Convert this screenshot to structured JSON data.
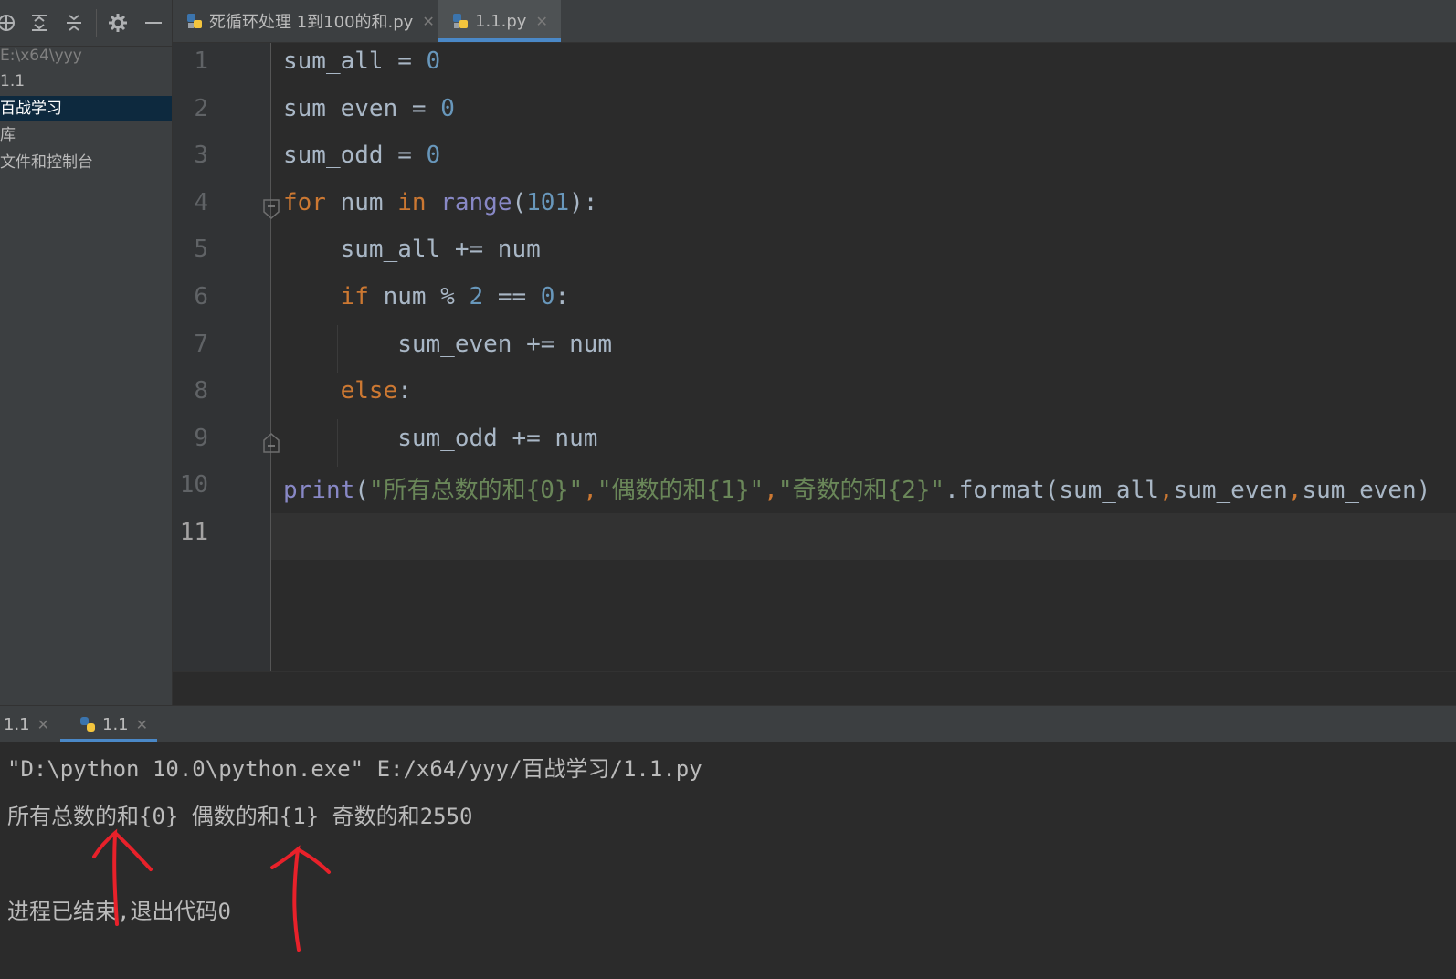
{
  "sidebar": {
    "items": [
      {
        "label": "E:\\x64\\yyy",
        "state": "dim"
      },
      {
        "label": "1.1",
        "state": "normal"
      },
      {
        "label": "百战学习",
        "state": "selected"
      },
      {
        "label": "库",
        "state": "normal"
      },
      {
        "label": "文件和控制台",
        "state": "normal"
      }
    ]
  },
  "editor_tabs": [
    {
      "label": "死循环处理 1到100的和.py",
      "active": false
    },
    {
      "label": "1.1.py",
      "active": true
    }
  ],
  "code": {
    "line_numbers": [
      "1",
      "2",
      "3",
      "4",
      "5",
      "6",
      "7",
      "8",
      "9",
      "10",
      "11"
    ],
    "current_line": "11",
    "lines": [
      [
        {
          "t": "sum_all = "
        },
        {
          "t": "0",
          "c": "num"
        }
      ],
      [
        {
          "t": "sum_even = "
        },
        {
          "t": "0",
          "c": "num"
        }
      ],
      [
        {
          "t": "sum_odd = "
        },
        {
          "t": "0",
          "c": "num"
        }
      ],
      [
        {
          "t": "for",
          "c": "kw"
        },
        {
          "t": " num "
        },
        {
          "t": "in",
          "c": "kw"
        },
        {
          "t": " "
        },
        {
          "t": "range",
          "c": "bi"
        },
        {
          "t": "("
        },
        {
          "t": "101",
          "c": "num"
        },
        {
          "t": "):"
        }
      ],
      [
        {
          "t": "    sum_all += num"
        }
      ],
      [
        {
          "t": "    "
        },
        {
          "t": "if",
          "c": "kw"
        },
        {
          "t": " num % "
        },
        {
          "t": "2",
          "c": "num"
        },
        {
          "t": " == "
        },
        {
          "t": "0",
          "c": "num"
        },
        {
          "t": ":"
        }
      ],
      [
        {
          "t": "        sum_even += num"
        }
      ],
      [
        {
          "t": "    "
        },
        {
          "t": "else",
          "c": "kw"
        },
        {
          "t": ":"
        }
      ],
      [
        {
          "t": "        sum_odd += num"
        }
      ],
      [
        {
          "t": "print",
          "c": "bi"
        },
        {
          "t": "("
        },
        {
          "t": "\"所有总数的和{0}\"",
          "c": "str"
        },
        {
          "t": ",",
          "c": "kw"
        },
        {
          "t": "\"偶数的和{1}\"",
          "c": "str"
        },
        {
          "t": ",",
          "c": "kw"
        },
        {
          "t": "\"奇数的和{2}\"",
          "c": "str"
        },
        {
          "t": ".format(sum_all"
        },
        {
          "t": ",",
          "c": "kw"
        },
        {
          "t": "sum_even"
        },
        {
          "t": ",",
          "c": "kw"
        },
        {
          "t": "sum_even)"
        }
      ],
      []
    ]
  },
  "run_tabs": [
    {
      "label": "1.1",
      "active": false
    },
    {
      "label": "1.1",
      "active": true
    }
  ],
  "console": {
    "lines": [
      "\"D:\\python 10.0\\python.exe\" E:/x64/yyy/百战学习/1.1.py",
      "所有总数的和{0} 偶数的和{1} 奇数的和2550",
      "",
      "进程已结束,退出代码0"
    ]
  },
  "colors": {
    "keyword": "#cc7832",
    "number": "#6897bb",
    "builtin": "#8888c6",
    "string": "#6a8759",
    "annotation": "#e8212a"
  },
  "icons": [
    "locate-icon",
    "expand-all-icon",
    "collapse-all-icon",
    "gear-icon",
    "hide-icon",
    "python-file-icon",
    "close-icon",
    "fold-icon"
  ]
}
